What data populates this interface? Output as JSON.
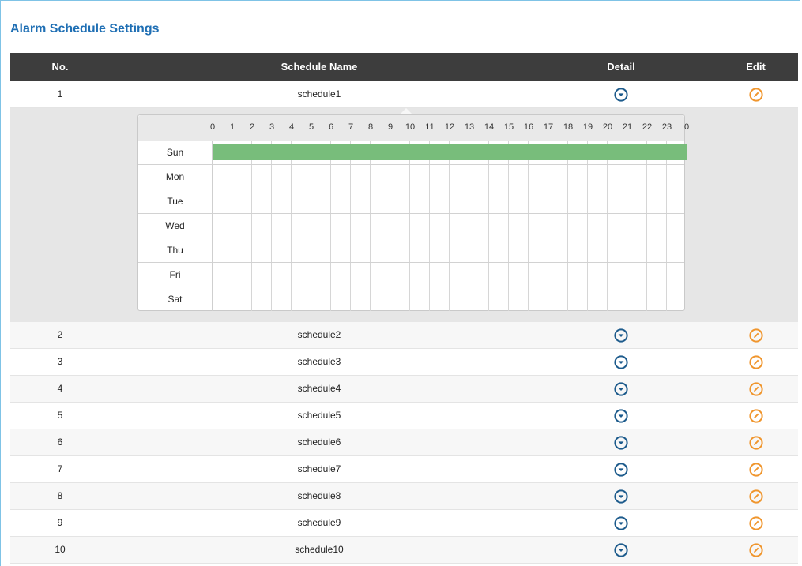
{
  "page": {
    "title": "Alarm Schedule Settings"
  },
  "table": {
    "headers": {
      "no": "No.",
      "name": "Schedule Name",
      "detail": "Detail",
      "edit": "Edit"
    },
    "rows": [
      {
        "no": "1",
        "name": "schedule1"
      },
      {
        "no": "2",
        "name": "schedule2"
      },
      {
        "no": "3",
        "name": "schedule3"
      },
      {
        "no": "4",
        "name": "schedule4"
      },
      {
        "no": "5",
        "name": "schedule5"
      },
      {
        "no": "6",
        "name": "schedule6"
      },
      {
        "no": "7",
        "name": "schedule7"
      },
      {
        "no": "8",
        "name": "schedule8"
      },
      {
        "no": "9",
        "name": "schedule9"
      },
      {
        "no": "10",
        "name": "schedule10"
      }
    ],
    "detail_icon": "chevron-down-circle-icon",
    "edit_icon": "pencil-circle-icon"
  },
  "schedule_detail": {
    "expanded_row": "1",
    "hours": [
      "0",
      "1",
      "2",
      "3",
      "4",
      "5",
      "6",
      "7",
      "8",
      "9",
      "10",
      "11",
      "12",
      "13",
      "14",
      "15",
      "16",
      "17",
      "18",
      "19",
      "20",
      "21",
      "22",
      "23",
      "0"
    ],
    "days": [
      {
        "label": "Sun",
        "active_ranges": [
          [
            0,
            24
          ]
        ]
      },
      {
        "label": "Mon",
        "active_ranges": []
      },
      {
        "label": "Tue",
        "active_ranges": []
      },
      {
        "label": "Wed",
        "active_ranges": []
      },
      {
        "label": "Thu",
        "active_ranges": []
      },
      {
        "label": "Fri",
        "active_ranges": []
      },
      {
        "label": "Sat",
        "active_ranges": []
      }
    ]
  },
  "colors": {
    "title": "#1f6fb4",
    "header_bg": "#3d3d3d",
    "detail_icon": "#1d5b8c",
    "edit_icon": "#f0962e",
    "active_slot": "#78bd7b"
  }
}
